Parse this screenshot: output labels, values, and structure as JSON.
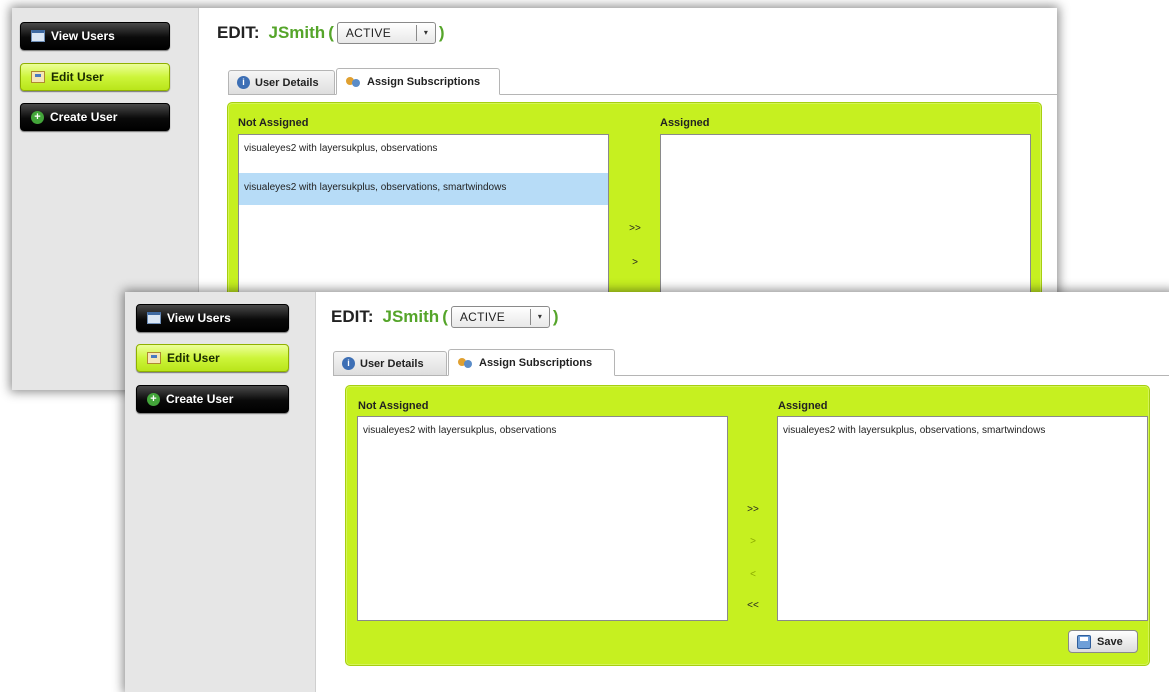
{
  "screens": [
    {
      "sidebar": {
        "items": [
          {
            "label": "View Users",
            "icon": "user-list-icon"
          },
          {
            "label": "Edit User",
            "icon": "edit-user-icon",
            "active": true
          },
          {
            "label": "Create User",
            "icon": "plus-circle-icon"
          }
        ]
      },
      "edit": {
        "prefix": "EDIT:",
        "username": "JSmith",
        "open_paren": "(",
        "close_paren": ")",
        "status": "ACTIVE",
        "dropdown_arrow": "▾"
      },
      "tabs": [
        {
          "label": "User Details",
          "icon": "info-icon",
          "selected": false
        },
        {
          "label": "Assign Subscriptions",
          "icon": "users-icon",
          "selected": true
        }
      ],
      "not_assigned": {
        "label": "Not Assigned",
        "items": [
          {
            "text": "visualeyes2 with layersukplus, observations",
            "selected": false
          },
          {
            "text": "visualeyes2 with layersukplus, observations, smartwindows",
            "selected": true
          }
        ]
      },
      "assigned": {
        "label": "Assigned",
        "items": []
      },
      "controls": {
        "add_all": ">>",
        "add": ">"
      }
    },
    {
      "sidebar": {
        "items": [
          {
            "label": "View Users",
            "icon": "user-list-icon"
          },
          {
            "label": "Edit User",
            "icon": "edit-user-icon",
            "active": true
          },
          {
            "label": "Create User",
            "icon": "plus-circle-icon"
          }
        ]
      },
      "edit": {
        "prefix": "EDIT:",
        "username": "JSmith",
        "open_paren": "(",
        "close_paren": ")",
        "status": "ACTIVE",
        "dropdown_arrow": "▾"
      },
      "tabs": [
        {
          "label": "User Details",
          "icon": "info-icon",
          "selected": false
        },
        {
          "label": "Assign Subscriptions",
          "icon": "users-icon",
          "selected": true
        }
      ],
      "not_assigned": {
        "label": "Not Assigned",
        "items": [
          {
            "text": "visualeyes2 with layersukplus, observations",
            "selected": false
          }
        ]
      },
      "assigned": {
        "label": "Assigned",
        "items": [
          {
            "text": "visualeyes2 with layersukplus, observations, smartwindows",
            "selected": false
          }
        ]
      },
      "controls": {
        "add_all": ">>",
        "add": ">",
        "remove": "<",
        "remove_all": "<<",
        "add_enabled": false,
        "remove_enabled": false
      },
      "save_label": "Save"
    }
  ],
  "colors": {
    "accent_green": "#c6f020",
    "username_green": "#55a52a",
    "selection_blue": "#b7dcf7"
  },
  "info_glyph": "i",
  "plus_glyph": "+"
}
